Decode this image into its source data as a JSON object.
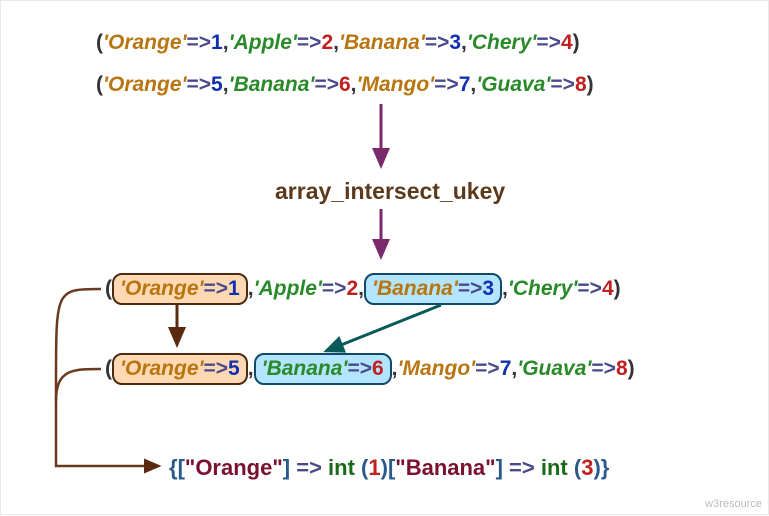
{
  "arrays": {
    "a": [
      {
        "key": "'Orange'",
        "val": "1",
        "keyColor": "#b87510",
        "valColor": "#1030b0"
      },
      {
        "key": "'Apple'",
        "val": "2",
        "keyColor": "#2a8a2a",
        "valColor": "#c02020"
      },
      {
        "key": "'Banana'",
        "val": "3",
        "keyColor": "#b87510",
        "valColor": "#1030b0"
      },
      {
        "key": "'Chery'",
        "val": "4",
        "keyColor": "#2a8a2a",
        "valColor": "#c02020"
      }
    ],
    "b": [
      {
        "key": "'Orange'",
        "val": "5",
        "keyColor": "#b87510",
        "valColor": "#1030b0"
      },
      {
        "key": "'Banana'",
        "val": "6",
        "keyColor": "#2a8a2a",
        "valColor": "#c02020"
      },
      {
        "key": "'Mango'",
        "val": "7",
        "keyColor": "#b87510",
        "valColor": "#1030b0"
      },
      {
        "key": "'Guava'",
        "val": "8",
        "keyColor": "#2a8a2a",
        "valColor": "#c02020"
      }
    ]
  },
  "funcName": "array_intersect_ukey",
  "highlight": {
    "a": {
      "Orange": "orange",
      "Banana": "blue"
    },
    "b": {
      "Orange": "orange",
      "Banana": "blue"
    }
  },
  "result": [
    {
      "key": "\"Orange\"",
      "val": "1"
    },
    {
      "key": "\"Banana\"",
      "val": "3"
    }
  ],
  "glyphs": {
    "assocArrow": "=>",
    "openParen": "(",
    "closeParen": ")",
    "comma": ",",
    "openBrace": "{",
    "closeBrace": "}",
    "openBracket": "[",
    "closeBracket": "]",
    "intWord": "int"
  },
  "attribution": "w3resource",
  "chart_data": {
    "type": "diagram",
    "function": "array_intersect_ukey",
    "input_array_1": {
      "Orange": 1,
      "Apple": 2,
      "Banana": 3,
      "Chery": 4
    },
    "input_array_2": {
      "Orange": 5,
      "Banana": 6,
      "Mango": 7,
      "Guava": 8
    },
    "matched_keys": [
      "Orange",
      "Banana"
    ],
    "output": {
      "Orange": 1,
      "Banana": 3
    }
  }
}
